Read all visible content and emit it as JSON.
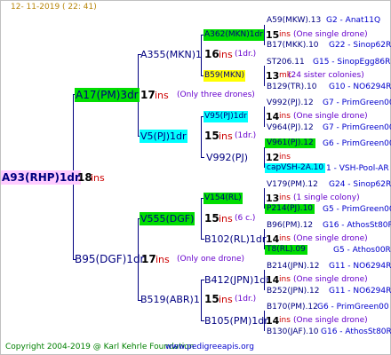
{
  "header": {
    "date": "12- 11-2019 ( 22: 41)"
  },
  "footer": {
    "copyright": "Copyright 2004-2019 @ Karl Kehrle Foundation",
    "url": "www.pedigreeapis.org"
  },
  "colors": {
    "green": "#00dd00",
    "yellow": "#ffff00",
    "cyan": "#00ffff",
    "pink": "#ffccff",
    "line": "#000080"
  },
  "root": {
    "name": "A93(RHP)1dr",
    "count": "18",
    "ins": "ins"
  },
  "g1": [
    {
      "name": "A17(PM)3dr",
      "count": "17",
      "ins": "ins",
      "note": "(Only three drones)"
    },
    {
      "name": "B95(DGF)1dr",
      "count": "17",
      "ins": "ins",
      "note": "(Only one drone)"
    }
  ],
  "g2": [
    {
      "name": "A355(MKN)1",
      "count": "16",
      "ins": "ins",
      "note": "(1dr.)"
    },
    {
      "name": "V5(PJ)1dr",
      "count": "15",
      "ins": "ins",
      "note": "(1dr.)"
    },
    {
      "name": "V555(DGF)",
      "count": "15",
      "ins": "ins",
      "note": "(6 c.)"
    },
    {
      "name": "B519(ABR)1",
      "count": "15",
      "ins": "ins",
      "note": "(1dr.)"
    }
  ],
  "g3": [
    {
      "name": "A362(MKN)1dr",
      "count": "15",
      "ins": "ins",
      "note": "(One single drone)"
    },
    {
      "name": "B59(MKN)",
      "count": "13",
      "ins": "mk",
      "note": "(24 sister colonies)"
    },
    {
      "name": "V95(PJ)1dr",
      "count": "14",
      "ins": "ins",
      "note": "(One single drone)"
    },
    {
      "name": "V992(PJ)",
      "count": "12",
      "ins": "ins",
      "note": ""
    },
    {
      "name": "V154(RL)",
      "count": "13",
      "ins": "ins",
      "note": "(1 single colony)"
    },
    {
      "name": "B102(RL)1dr",
      "count": "14",
      "ins": "ins",
      "note": "(One single drone)"
    },
    {
      "name": "B412(JPN)1dr",
      "count": "14",
      "ins": "ins",
      "note": "(One single drone)"
    },
    {
      "name": "B105(PM)1dr",
      "count": "14",
      "ins": "ins",
      "note": "(One single drone)"
    }
  ],
  "g4": [
    {
      "name": "A59(MKW).13",
      "info": "G2 - Anat11Q"
    },
    {
      "name": "B17(MKK).10",
      "info": "G22 - Sinop62R"
    },
    {
      "name": "ST206.11",
      "info": "G15 - SinopEgg86R"
    },
    {
      "name": "B129(TR).10",
      "info": "G10 - NO6294R"
    },
    {
      "name": "V992(PJ).12",
      "info": "G7 - PrimGreen00"
    },
    {
      "name": "V964(PJ).12",
      "info": "G7 - PrimGreen00"
    },
    {
      "name": "V961(PJ).12",
      "info": "G6 - PrimGreen00"
    },
    {
      "name": "capVSH-2A.10",
      "info": "1 - VSH-Pool-AR"
    },
    {
      "name": "V179(PM).12",
      "info": "G24 - Sinop62R"
    },
    {
      "name": "P214(PJ).10",
      "info": "G5 - PrimGreen00"
    },
    {
      "name": "B96(PM).12",
      "info": "G16 - AthosSt80R"
    },
    {
      "name": "T8(RL).09",
      "info": "G5 - Athos00R"
    },
    {
      "name": "B214(JPN).12",
      "info": "G11 - NO6294R"
    },
    {
      "name": "B252(JPN).12",
      "info": "G11 - NO6294R"
    },
    {
      "name": "B170(PM).12",
      "info": "G6 - PrimGreen00"
    },
    {
      "name": "B130(JAF).10",
      "info": "G16 - AthosSt80R"
    }
  ]
}
